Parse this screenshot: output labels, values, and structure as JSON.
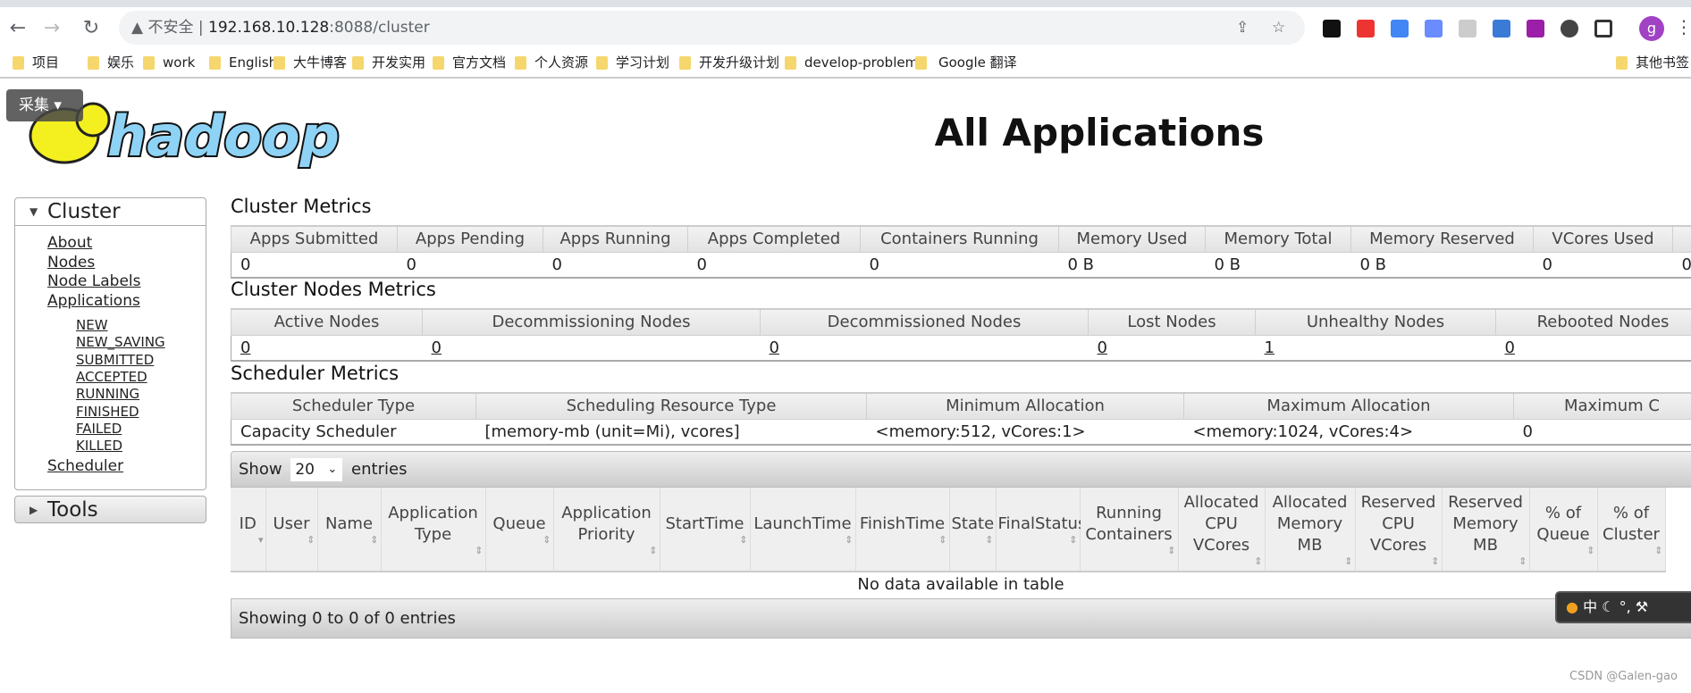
{
  "browser": {
    "security": "不安全",
    "url_host": "192.168.10.128",
    "url_rest": ":8088/cluster",
    "profile": "g",
    "bookmarks": [
      "项目",
      "娱乐",
      "work",
      "English",
      "大牛博客",
      "开发实用",
      "官方文档",
      "个人资源",
      "学习计划",
      "开发升级计划",
      "develop-problems",
      "Google 翻译",
      "其他书签"
    ]
  },
  "overlay": {
    "caiji": "采集 ▾"
  },
  "logo": "hadoop",
  "page_title": "All Applications",
  "sidebar": {
    "cluster": "Cluster",
    "links": [
      "About",
      "Nodes",
      "Node Labels",
      "Applications"
    ],
    "states": [
      "NEW",
      "NEW_SAVING",
      "SUBMITTED",
      "ACCEPTED",
      "RUNNING",
      "FINISHED",
      "FAILED",
      "KILLED"
    ],
    "scheduler": "Scheduler",
    "tools": "Tools"
  },
  "cluster_metrics": {
    "title": "Cluster Metrics",
    "headers": [
      "Apps Submitted",
      "Apps Pending",
      "Apps Running",
      "Apps Completed",
      "Containers Running",
      "Memory Used",
      "Memory Total",
      "Memory Reserved",
      "VCores Used",
      "V"
    ],
    "values": [
      "0",
      "0",
      "0",
      "0",
      "0",
      "0 B",
      "0 B",
      "0 B",
      "0",
      "0"
    ]
  },
  "nodes_metrics": {
    "title": "Cluster Nodes Metrics",
    "headers": [
      "Active Nodes",
      "Decommissioning Nodes",
      "Decommissioned Nodes",
      "Lost Nodes",
      "Unhealthy Nodes",
      "Rebooted Nodes"
    ],
    "values": [
      "0",
      "0",
      "0",
      "0",
      "1",
      "0"
    ]
  },
  "scheduler_metrics": {
    "title": "Scheduler Metrics",
    "headers": [
      "Scheduler Type",
      "Scheduling Resource Type",
      "Minimum Allocation",
      "Maximum Allocation",
      "Maximum C"
    ],
    "values": [
      "Capacity Scheduler",
      "[memory-mb (unit=Mi), vcores]",
      "<memory:512, vCores:1>",
      "<memory:1024, vCores:4>",
      "0"
    ]
  },
  "apps": {
    "show": "Show",
    "page_size": "20",
    "entries": "entries",
    "headers": [
      "ID",
      "User",
      "Name",
      "Application Type",
      "Queue",
      "Application Priority",
      "StartTime",
      "LaunchTime",
      "FinishTime",
      "State",
      "FinalStatus",
      "Running Containers",
      "Allocated CPU VCores",
      "Allocated Memory MB",
      "Reserved CPU VCores",
      "Reserved Memory MB",
      "% of Queue",
      "% of Cluster"
    ],
    "empty": "No data available in table",
    "info": "Showing 0 to 0 of 0 entries"
  },
  "float_toolbar": {
    "lang": "中"
  },
  "watermark": "CSDN @Galen-gao"
}
